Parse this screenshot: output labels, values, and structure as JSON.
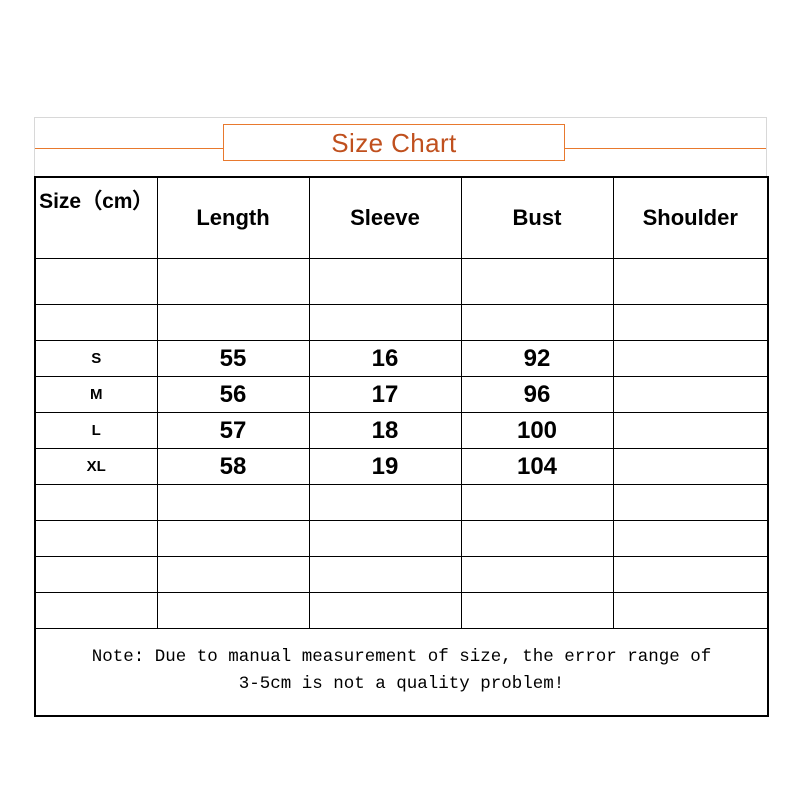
{
  "chart_data": {
    "type": "table",
    "title": "Size Chart",
    "columns": [
      "Size（cm）",
      "Length",
      "Sleeve",
      "Bust",
      "Shoulder"
    ],
    "rows": [
      {
        "size": "S",
        "length": "55",
        "sleeve": "16",
        "bust": "92",
        "shoulder": ""
      },
      {
        "size": "M",
        "length": "56",
        "sleeve": "17",
        "bust": "96",
        "shoulder": ""
      },
      {
        "size": "L",
        "length": "57",
        "sleeve": "18",
        "bust": "100",
        "shoulder": ""
      },
      {
        "size": "XL",
        "length": "58",
        "sleeve": "19",
        "bust": "104",
        "shoulder": ""
      }
    ],
    "units": "cm",
    "note": "Note: Due to manual measurement of size, the error range of\n3-5cm is not a quality problem!",
    "empty_rows_above_data": 2,
    "empty_rows_below_data": 4,
    "grid": true,
    "legend": "none"
  },
  "title": {
    "text": "Size Chart",
    "color": "#c0501e",
    "rule_color": "#e8792e"
  },
  "table": {
    "headers": {
      "size": "Size（cm）",
      "length": "Length",
      "sleeve": "Sleeve",
      "bust": "Bust",
      "shoulder": "Shoulder"
    },
    "rows": [
      {
        "size": "S",
        "length": "55",
        "sleeve": "16",
        "bust": "92",
        "shoulder": ""
      },
      {
        "size": "M",
        "length": "56",
        "sleeve": "17",
        "bust": "96",
        "shoulder": ""
      },
      {
        "size": "L",
        "length": "57",
        "sleeve": "18",
        "bust": "100",
        "shoulder": ""
      },
      {
        "size": "XL",
        "length": "58",
        "sleeve": "19",
        "bust": "104",
        "shoulder": ""
      }
    ],
    "empty": "",
    "border_color": "#000000"
  },
  "note": {
    "line1": "Note: Due to manual measurement of size, the error range of",
    "line2": "3-5cm is not a quality problem!",
    "full": "Note: Due to manual measurement of size, the error range of\n3-5cm is not a quality problem!"
  }
}
